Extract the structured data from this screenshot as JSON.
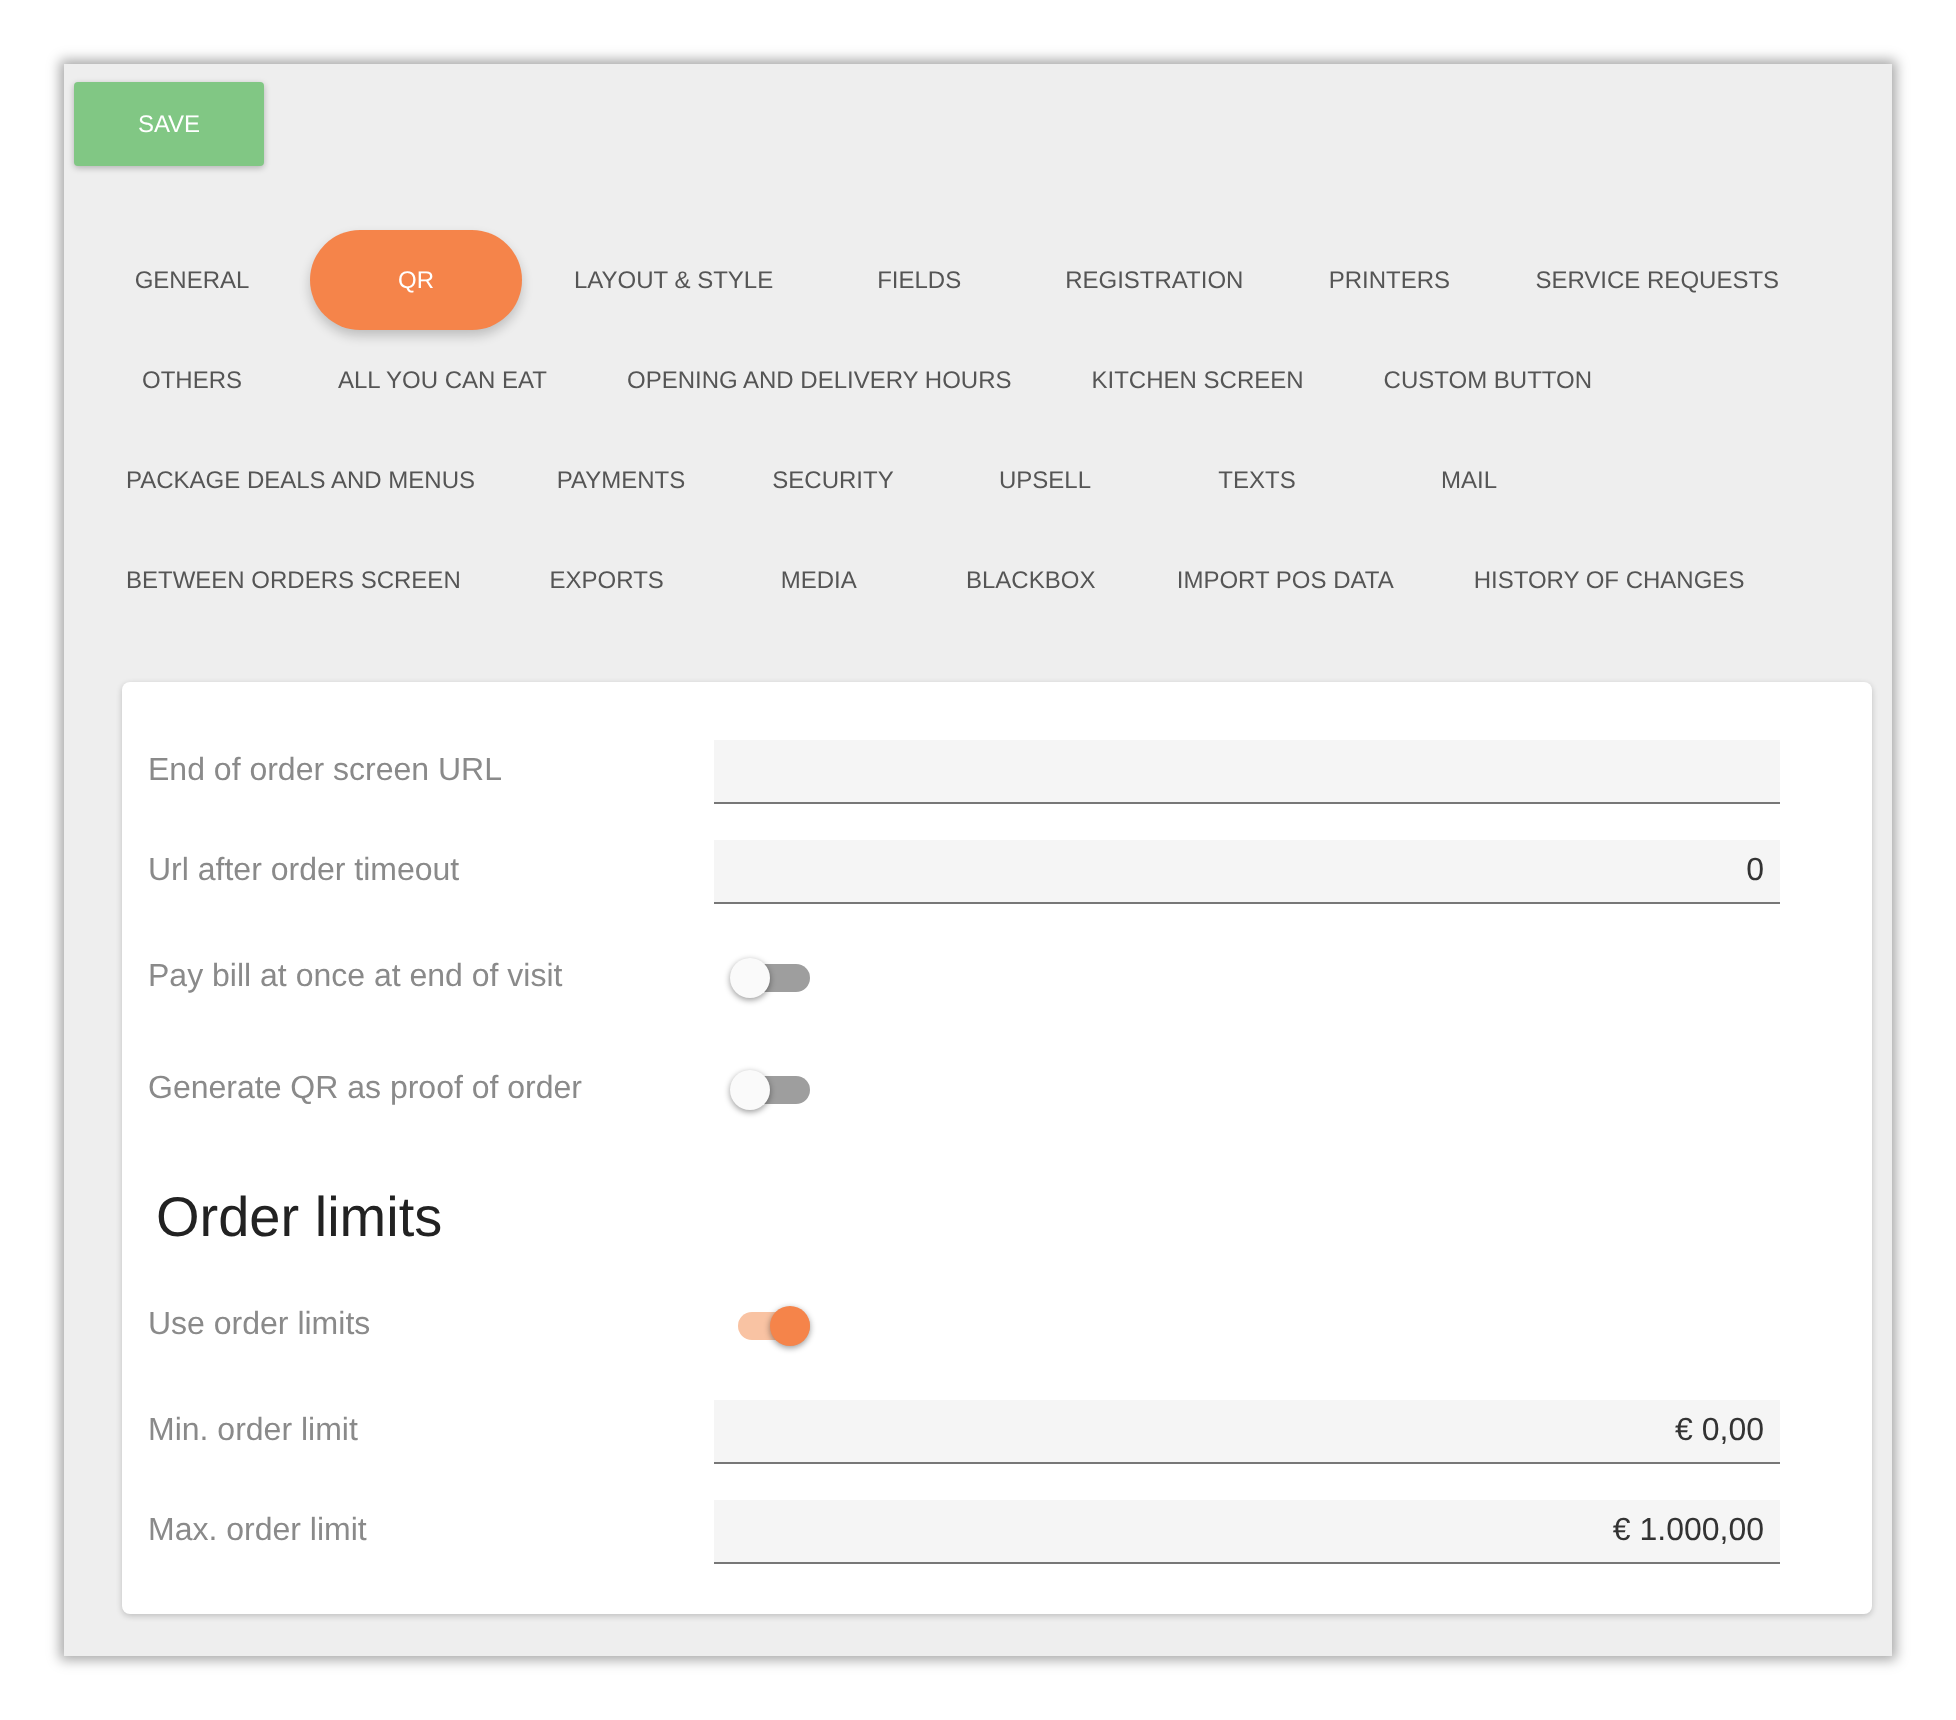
{
  "save_button": {
    "label": "SAVE"
  },
  "tab_rows": [
    [
      {
        "label": "GENERAL",
        "selected": false
      },
      {
        "label": "QR",
        "selected": true
      },
      {
        "label": "LAYOUT & STYLE",
        "selected": false
      },
      {
        "label": "FIELDS",
        "selected": false
      },
      {
        "label": "REGISTRATION",
        "selected": false
      },
      {
        "label": "PRINTERS",
        "selected": false
      },
      {
        "label": "SERVICE REQUESTS",
        "selected": false
      }
    ],
    [
      {
        "label": "OTHERS",
        "selected": false
      },
      {
        "label": "ALL YOU CAN EAT",
        "selected": false
      },
      {
        "label": "OPENING AND DELIVERY HOURS",
        "selected": false
      },
      {
        "label": "KITCHEN SCREEN",
        "selected": false
      },
      {
        "label": "CUSTOM BUTTON",
        "selected": false
      }
    ],
    [
      {
        "label": "PACKAGE DEALS AND MENUS",
        "selected": false
      },
      {
        "label": "PAYMENTS",
        "selected": false
      },
      {
        "label": "SECURITY",
        "selected": false
      },
      {
        "label": "UPSELL",
        "selected": false
      },
      {
        "label": "TEXTS",
        "selected": false
      },
      {
        "label": "MAIL",
        "selected": false
      }
    ],
    [
      {
        "label": "BETWEEN ORDERS SCREEN",
        "selected": false
      },
      {
        "label": "EXPORTS",
        "selected": false
      },
      {
        "label": "MEDIA",
        "selected": false
      },
      {
        "label": "BLACKBOX",
        "selected": false
      },
      {
        "label": "IMPORT POS DATA",
        "selected": false
      },
      {
        "label": "HISTORY OF CHANGES",
        "selected": false
      }
    ]
  ],
  "settings": [
    {
      "kind": "field",
      "label": "End of order screen URL"
    },
    {
      "kind": "field",
      "label": "Url after order timeout",
      "value": "0"
    },
    {
      "kind": "toggle",
      "label": "Pay bill at once at end of visit",
      "on": false
    },
    {
      "kind": "toggle",
      "label": "Generate QR as proof of order",
      "on": false
    },
    {
      "kind": "heading",
      "label": "Order limits"
    },
    {
      "kind": "toggle",
      "label": "Use order limits",
      "on": true
    },
    {
      "kind": "field",
      "label": "Min. order limit",
      "value": "€ 0,00"
    },
    {
      "kind": "field",
      "label": "Max. order limit",
      "value": "€ 1.000,00"
    }
  ]
}
